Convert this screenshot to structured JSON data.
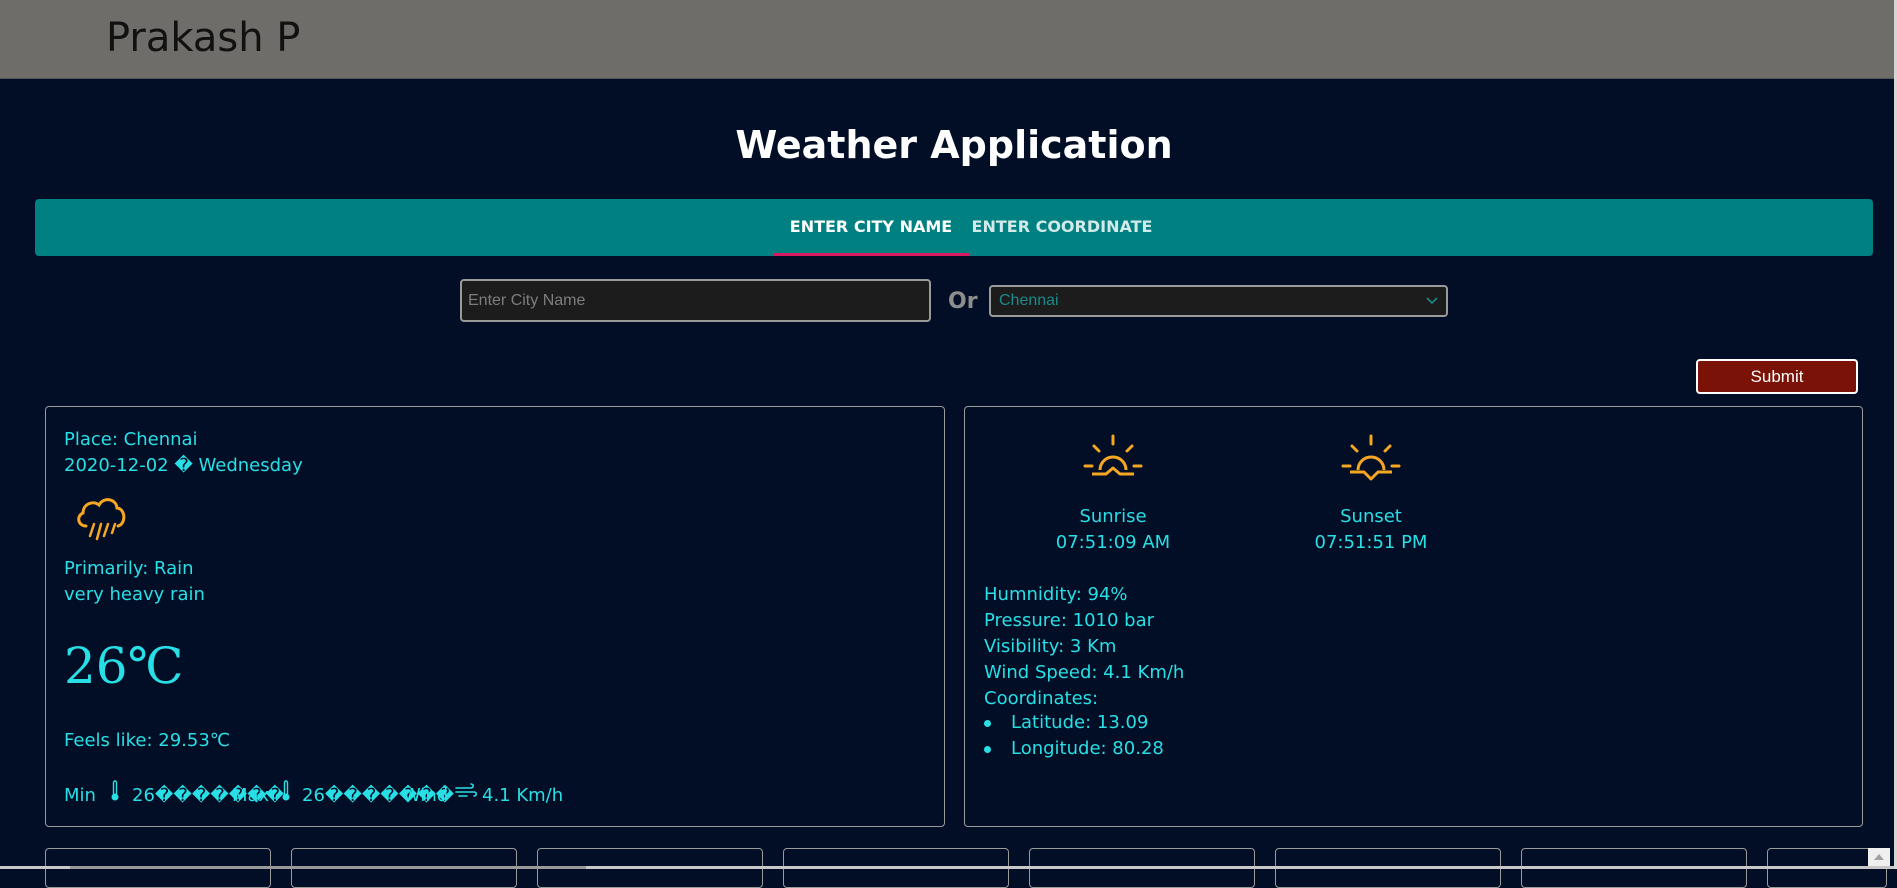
{
  "header": {
    "name": "Prakash P"
  },
  "page": {
    "title": "Weather Application"
  },
  "tabs": [
    {
      "label": "ENTER CITY NAME",
      "active": true
    },
    {
      "label": "ENTER COORDINATE",
      "active": false
    }
  ],
  "search": {
    "placeholder": "Enter City Name",
    "value": "",
    "or_label": "Or",
    "selected_city": "Chennai",
    "submit_label": "Submit"
  },
  "current": {
    "place": "Place: Chennai",
    "date": "2020-12-02 � Wednesday",
    "weather_icon": "rain-cloud-icon",
    "primarily": "Primarily: Rain",
    "description": "very heavy rain",
    "temperature": "26℃",
    "feels_like": "Feels like: 29.53℃",
    "min_label": "Min",
    "min_value": "26�������",
    "max_label": "Max",
    "max_value": "26�������",
    "wind_label": "Wind",
    "wind_value": "4.1 Km/h"
  },
  "details": {
    "sunrise_label": "Sunrise",
    "sunrise_time": "07:51:09 AM",
    "sunset_label": "Sunset",
    "sunset_time": "07:51:51 PM",
    "humidity": "Humnidity: 94%",
    "pressure": "Pressure: 1010 bar",
    "visibility": "Visibility: 3 Km",
    "wind_speed": "Wind Speed: 4.1 Km/h",
    "coordinates_label": "Coordinates:",
    "latitude": "Latitude: 13.09",
    "longitude": "Longitude: 80.28"
  },
  "colors": {
    "background": "#020e26",
    "header": "#6e6d69",
    "tab_bar": "#008080",
    "tab_indicator": "#d81b60",
    "accent_text": "#29dfe6",
    "icon": "#f5a623",
    "submit": "#7a1208"
  }
}
